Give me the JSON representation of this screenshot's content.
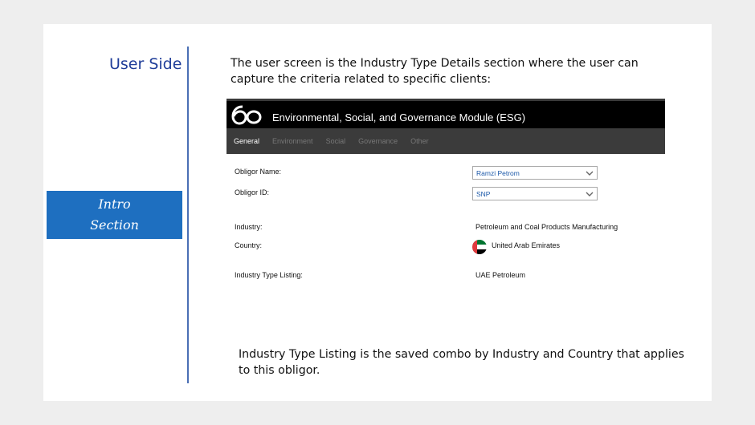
{
  "slide": {
    "heading": "User Side",
    "intro_line1": "Intro",
    "intro_line2": "Section",
    "description": "The user screen is the Industry Type Details section where the user can capture the criteria related to specific clients:",
    "footer_note": "Industry Type Listing is the saved combo by Industry and Country that applies to this obligor."
  },
  "app": {
    "logo_icon": "6o-logo-icon",
    "title": "Environmental, Social, and Governance Module (ESG)",
    "tabs": [
      "General",
      "Environment",
      "Social",
      "Governance",
      "Other"
    ],
    "active_tab": "General",
    "colors": {
      "header": "#000000",
      "tabbar": "#3b3b3b",
      "select_text": "#1a57a8"
    },
    "form": {
      "obligor_name_label": "Obligor Name:",
      "obligor_name_value": "Ramzi Petrom",
      "obligor_id_label": "Obligor ID:",
      "obligor_id_value": "SNP",
      "industry_label": "Industry:",
      "industry_value": "Petroleum and Coal Products Manufacturing",
      "country_label": "Country:",
      "country_value": "United Arab Emirates",
      "country_flag_icon": "uae-flag-icon",
      "listing_label": "Industry Type Listing:",
      "listing_value": "UAE Petroleum"
    }
  }
}
